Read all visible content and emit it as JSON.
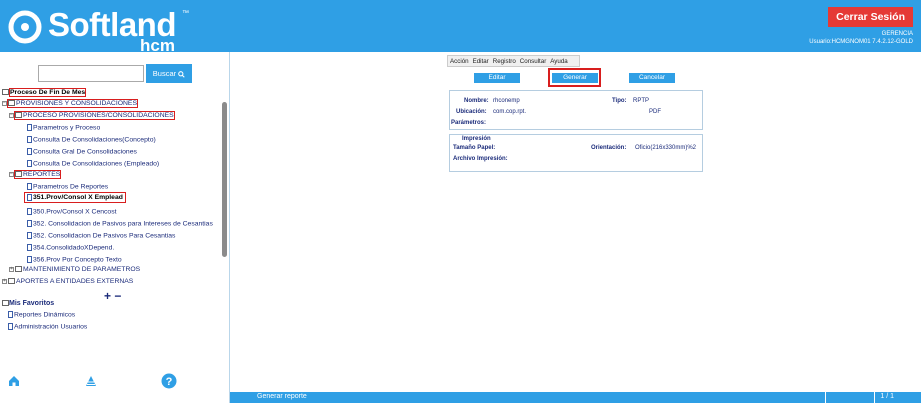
{
  "header": {
    "logo_text": "Softland",
    "logo_tm": "™",
    "logo_sub": "hcm",
    "logout_label": "Cerrar Sesión",
    "role": "GERENCIA",
    "user": "Usuario:HCMGNOM01 7.4.2.12-GOLD",
    "colors": {
      "header_bg": "#2f9fe5",
      "logout_bg": "#e53935"
    }
  },
  "search": {
    "value": "",
    "button_label": "Buscar"
  },
  "tree": {
    "root": "Proceso De Fin De Mes",
    "provisiones": "PROVISIONES Y CONSOLIDACIONES",
    "proceso": "PROCESO PROVISIONES/CONSOLIDACIONES",
    "proceso_items": [
      "Parametros y Proceso",
      "Consulta De Consolidaciones(Concepto)",
      "Consulta Gral De Consolidaciones",
      "Consulta De Consolidaciones (Empleado)"
    ],
    "reportes": "REPORTES",
    "reportes_items": [
      "Parametros De Reportes",
      "351.Prov/Consol X Emplead",
      "350.Prov/Consol X Cencost",
      "352. Consolidacion de Pasivos para Intereses de Cesantias",
      "352. Consolidacion De Pasivos Para Cesantias",
      "354.ConsolidadoXDepend.",
      "356.Prov Por Concepto Texto"
    ],
    "mantenimiento": "MANTENIMIENTO DE PARAMETROS",
    "aportes": "APORTES A ENTIDADES EXTERNAS",
    "expand_label": "+",
    "collapse_label": "−"
  },
  "favorites": {
    "title": "Mis Favoritos",
    "items": [
      "Reportes Dinámicos",
      "Administración Usuarios"
    ]
  },
  "bottom_icons": [
    "home-icon",
    "triangle-stack-icon",
    "help-icon"
  ],
  "menu": {
    "items": [
      "Acción",
      "Editar",
      "Registro",
      "Consultar",
      "Ayuda"
    ]
  },
  "actions": {
    "edit": "Editar",
    "generate": "Generar",
    "cancel": "Cancelar"
  },
  "form": {
    "nombre_label": "Nombre:",
    "nombre_value": "rhconemp",
    "tipo_label": "Tipo:",
    "tipo_value": "RPTP",
    "ubicacion_label": "Ubicación:",
    "ubicacion_value": "com.cop.rpt.",
    "pdf_value": "PDF",
    "parametros_label": "Parámetros:",
    "impresion_title": "Impresión",
    "tamano_label": "Tamaño Papel:",
    "orientacion_label": "Orientación:",
    "orientacion_value": "Oficio(216x330mm)%2",
    "archivo_label": "Archivo Impresión:"
  },
  "status": {
    "text": "Generar reporte",
    "page": "1 / 1"
  }
}
